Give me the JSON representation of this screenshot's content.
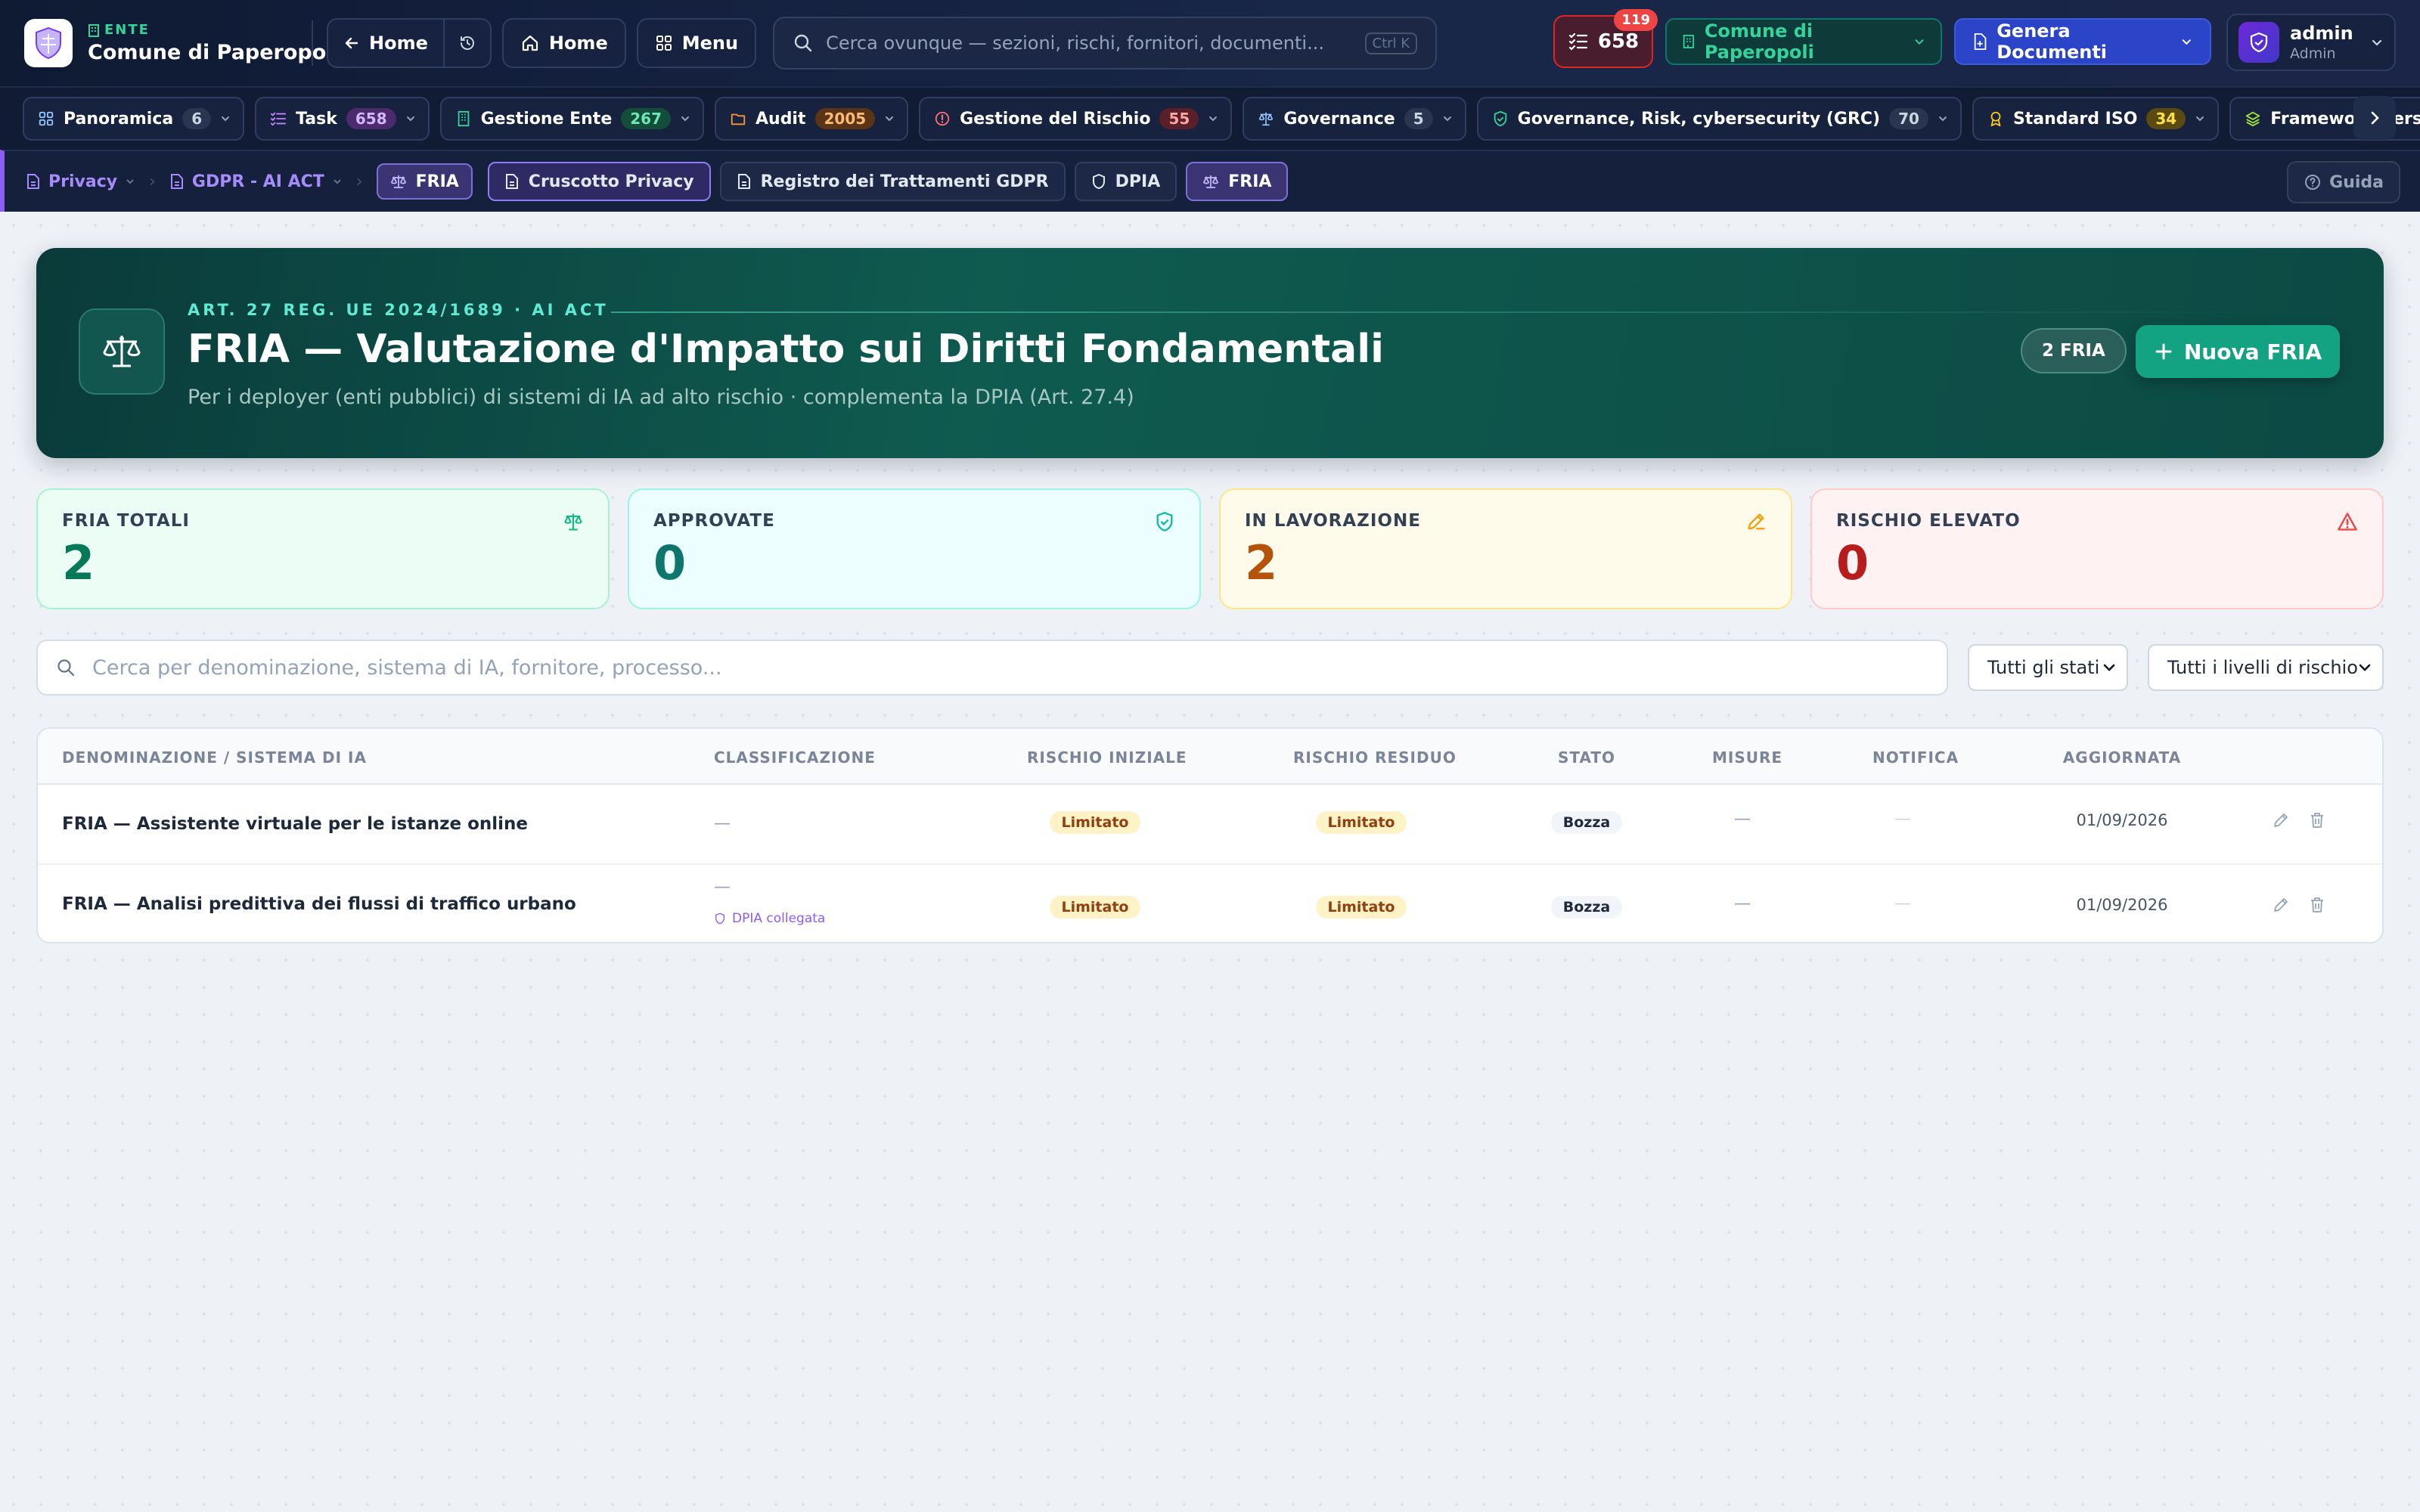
{
  "topbar": {
    "ente_tag": "ENTE",
    "ente_name": "Comune di Paperopoli",
    "back_label": "Home",
    "home_label": "Home",
    "menu_label": "Menu",
    "search_placeholder": "Cerca ovunque — sezioni, rischi, fornitori, documenti...",
    "search_shortcut": "Ctrl K",
    "task_count": "658",
    "notification_count": "119",
    "ente_selector": "Comune di Paperopoli",
    "generate_label": "Genera Documenti",
    "user_name": "admin",
    "user_role": "Admin"
  },
  "modules": [
    {
      "label": "Panoramica",
      "count": "6",
      "icon": "grid-icon",
      "color": "#93c5fd",
      "badge_bg": "#2a3550",
      "badge_fg": "#cbd5e1"
    },
    {
      "label": "Task",
      "count": "658",
      "icon": "tasklist-icon",
      "color": "#c084fc",
      "badge_bg": "#4b2a6e",
      "badge_fg": "#d8b4fe"
    },
    {
      "label": "Gestione Ente",
      "count": "267",
      "icon": "building-icon",
      "color": "#34d399",
      "badge_bg": "#134e3a",
      "badge_fg": "#6ee7b7"
    },
    {
      "label": "Audit",
      "count": "2005",
      "icon": "folder-icon",
      "color": "#fb923c",
      "badge_bg": "#5a3414",
      "badge_fg": "#fdba74"
    },
    {
      "label": "Gestione del Rischio",
      "count": "55",
      "icon": "alert-circle-icon",
      "color": "#f87171",
      "badge_bg": "#5a1f28",
      "badge_fg": "#fca5a5"
    },
    {
      "label": "Governance",
      "count": "5",
      "icon": "scale-icon",
      "color": "#93c5fd",
      "badge_bg": "#2a3550",
      "badge_fg": "#cbd5e1"
    },
    {
      "label": "Governance, Risk, cybersecurity (GRC)",
      "count": "70",
      "icon": "shield-check-icon",
      "color": "#34d399",
      "badge_bg": "#2a3550",
      "badge_fg": "#cbd5e1"
    },
    {
      "label": "Standard ISO",
      "count": "34",
      "icon": "award-icon",
      "color": "#facc15",
      "badge_bg": "#5a4a10",
      "badge_fg": "#fde047"
    },
    {
      "label": "Framework Personalizzati",
      "count": "",
      "icon": "layers-icon",
      "color": "#a3e635",
      "badge_bg": "",
      "badge_fg": ""
    }
  ],
  "subnav": {
    "crumb_privacy": "Privacy",
    "crumb_gdpr": "GDPR - AI ACT",
    "crumb_fria": "FRIA",
    "tabs": [
      "Cruscotto Privacy",
      "Registro dei Trattamenti GDPR",
      "DPIA",
      "FRIA"
    ],
    "guide_label": "Guida"
  },
  "hero": {
    "kicker": "ART. 27 REG. UE 2024/1689 · AI ACT",
    "title": "FRIA — Valutazione d'Impatto sui Diritti Fondamentali",
    "subtitle": "Per i deployer (enti pubblici) di sistemi di IA ad alto rischio · complementa la DPIA (Art. 27.4)",
    "count_badge": "2 FRIA",
    "new_button": "Nuova FRIA"
  },
  "stats": [
    {
      "label": "FRIA TOTALI",
      "value": "2",
      "icon": "scale-icon",
      "bg": "#ecfdf5",
      "border": "#a7f3d0",
      "label_color": "#334155",
      "value_color": "#047857",
      "icon_color": "#10b981"
    },
    {
      "label": "APPROVATE",
      "value": "0",
      "icon": "shield-check-icon",
      "bg": "#ecfeff",
      "border": "#99f6e4",
      "label_color": "#334155",
      "value_color": "#0f766e",
      "icon_color": "#14b8a6"
    },
    {
      "label": "IN LAVORAZIONE",
      "value": "2",
      "icon": "pencil-icon",
      "bg": "#fffbeb",
      "border": "#fde68a",
      "label_color": "#334155",
      "value_color": "#b45309",
      "icon_color": "#f59e0b"
    },
    {
      "label": "RISCHIO ELEVATO",
      "value": "0",
      "icon": "warning-triangle-icon",
      "bg": "#fef2f2",
      "border": "#fecaca",
      "label_color": "#334155",
      "value_color": "#b91c1c",
      "icon_color": "#ef4444"
    }
  ],
  "filters": {
    "search_placeholder": "Cerca per denominazione, sistema di IA, fornitore, processo...",
    "status_select": "Tutti gli stati",
    "risk_select": "Tutti i livelli di rischio"
  },
  "table": {
    "headers": [
      "DENOMINAZIONE / SISTEMA DI IA",
      "CLASSIFICAZIONE",
      "RISCHIO INIZIALE",
      "RISCHIO RESIDUO",
      "STATO",
      "MISURE",
      "NOTIFICA",
      "AGGIORNATA"
    ],
    "rows": [
      {
        "name": "FRIA — Assistente virtuale per le istanze online",
        "classification": "—",
        "link": "",
        "initial_risk": "Limitato",
        "residual_risk": "Limitato",
        "status": "Bozza",
        "measures": "—",
        "notification": "—",
        "updated": "01/09/2026"
      },
      {
        "name": "FRIA — Analisi predittiva dei flussi di traffico urbano",
        "classification": "—",
        "link": "DPIA collegata",
        "initial_risk": "Limitato",
        "residual_risk": "Limitato",
        "status": "Bozza",
        "measures": "—",
        "notification": "—",
        "updated": "01/09/2026"
      }
    ]
  }
}
